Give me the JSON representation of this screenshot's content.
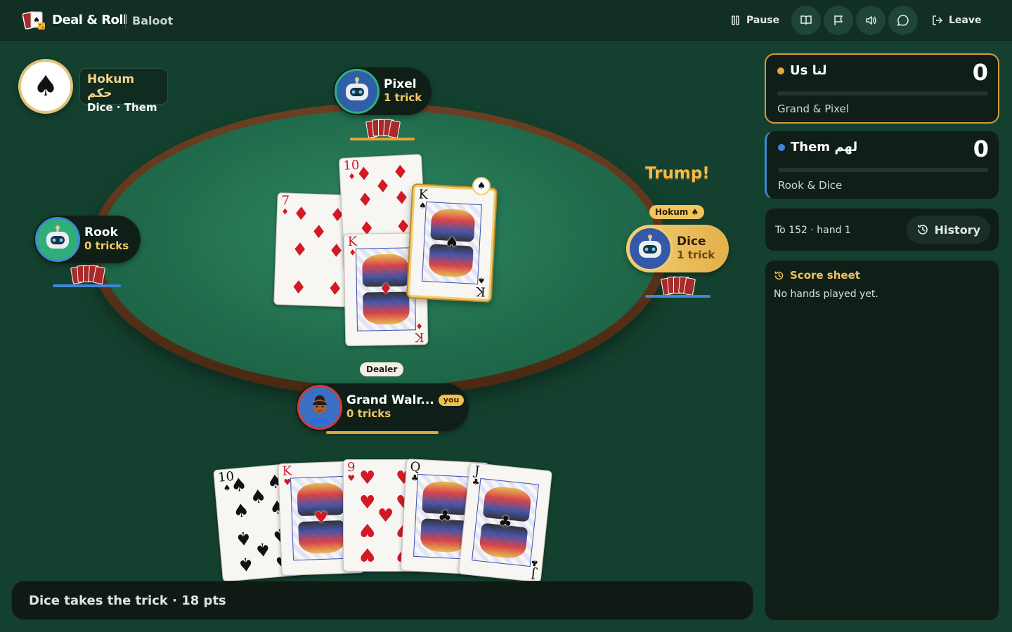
{
  "app": {
    "brand": "Deal & Roll",
    "game": "Baloot"
  },
  "toolbar": {
    "pause_label": "Pause",
    "leave_label": "Leave"
  },
  "contract": {
    "suit": "♠",
    "type": "Hokum حكم",
    "by": "Dice · Them"
  },
  "players": {
    "top": {
      "name": "Pixel",
      "tricks": "1 trick"
    },
    "left": {
      "name": "Rook",
      "tricks": "0 tricks"
    },
    "right": {
      "name": "Dice",
      "tricks": "1 trick",
      "badge": "Hokum ♠"
    },
    "bottom": {
      "name": "Grand Walr...",
      "tricks": "0 tricks",
      "you": "you",
      "dealer_badge": "Dealer"
    }
  },
  "trump_label": "Trump!",
  "trick_cards": [
    {
      "rank": "7",
      "suit": "♦",
      "color": "red"
    },
    {
      "rank": "10",
      "suit": "♦",
      "color": "red"
    },
    {
      "rank": "K",
      "suit": "♦",
      "color": "red"
    },
    {
      "rank": "K",
      "suit": "♠",
      "color": "black",
      "highlight": true
    }
  ],
  "hand": [
    {
      "rank": "10",
      "suit": "♠",
      "color": "black"
    },
    {
      "rank": "K",
      "suit": "♥",
      "color": "red"
    },
    {
      "rank": "9",
      "suit": "♥",
      "color": "red"
    },
    {
      "rank": "Q",
      "suit": "♣",
      "color": "black"
    },
    {
      "rank": "J",
      "suit": "♣",
      "color": "black"
    }
  ],
  "scores": {
    "us": {
      "label": "Us لنا",
      "score": "0",
      "members": "Grand & Pixel",
      "color": "#e2a63a"
    },
    "them": {
      "label": "Them لهم",
      "score": "0",
      "members": "Rook & Dice",
      "color": "#3f86d6"
    }
  },
  "target": "To 152 · hand 1",
  "history_label": "History",
  "score_sheet": {
    "title": "Score sheet",
    "empty": "No hands played yet."
  },
  "status": "Dice takes the trick · 18 pts"
}
